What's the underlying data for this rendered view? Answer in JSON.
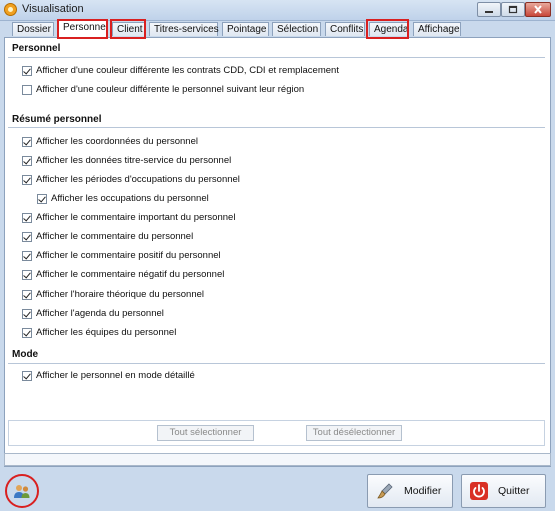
{
  "window": {
    "title": "Visualisation"
  },
  "tabs": [
    {
      "label": "Dossier"
    },
    {
      "label": "Personnel"
    },
    {
      "label": "Client"
    },
    {
      "label": "Titres-services"
    },
    {
      "label": "Pointage"
    },
    {
      "label": "Sélection"
    },
    {
      "label": "Conflits"
    },
    {
      "label": "Agenda"
    },
    {
      "label": "Affichage"
    }
  ],
  "sections": {
    "personnel": {
      "title": "Personnel",
      "items": [
        {
          "label": "Afficher d'une couleur différente les contrats CDD, CDI et remplacement",
          "checked": true
        },
        {
          "label": "Afficher d'une couleur différente le personnel suivant leur région",
          "checked": false
        }
      ]
    },
    "resume": {
      "title": "Résumé personnel",
      "items": [
        {
          "label": "Afficher les coordonnées du personnel",
          "checked": true
        },
        {
          "label": "Afficher les données titre-service du personnel",
          "checked": true
        },
        {
          "label": "Afficher les périodes d'occupations du personnel",
          "checked": true
        },
        {
          "label": "Afficher les occupations du personnel",
          "checked": true
        },
        {
          "label": "Afficher le commentaire important du personnel",
          "checked": true
        },
        {
          "label": "Afficher le commentaire du personnel",
          "checked": true
        },
        {
          "label": "Afficher le commentaire positif du personnel",
          "checked": true
        },
        {
          "label": "Afficher le commentaire négatif du personnel",
          "checked": true
        },
        {
          "label": "Afficher l'horaire théorique du personnel",
          "checked": true
        },
        {
          "label": "Afficher l'agenda du personnel",
          "checked": true
        },
        {
          "label": "Afficher les équipes du personnel",
          "checked": true
        }
      ]
    },
    "mode": {
      "title": "Mode",
      "items": [
        {
          "label": "Afficher le personnel en mode détaillé",
          "checked": true
        }
      ]
    }
  },
  "buttons": {
    "select_all": "Tout sélectionner",
    "deselect_all": "Tout désélectionner",
    "modify": "Modifier",
    "quit": "Quitter"
  },
  "icons": {
    "app": "app-icon",
    "modify": "brush-icon",
    "quit": "power-icon",
    "users": "users-icon"
  },
  "colors": {
    "highlight": "#d92020",
    "quit_red": "#d93025"
  }
}
